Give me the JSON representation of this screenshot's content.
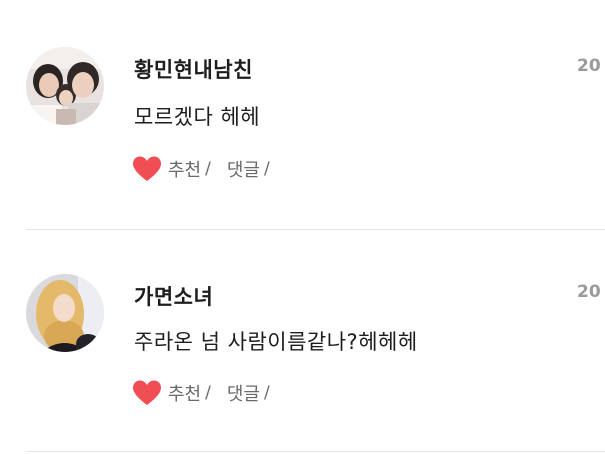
{
  "comments": [
    {
      "username": "황민현내남친",
      "date": "20",
      "body": "모르겠다 헤헤",
      "recommend_label": "추천",
      "reply_label": "댓글",
      "separator": "/"
    },
    {
      "username": "가면소녀",
      "date": "20",
      "body": "주라온 넘 사람이름같나?헤헤헤",
      "recommend_label": "추천",
      "reply_label": "댓글",
      "separator": "/"
    }
  ],
  "colors": {
    "heart": "#f04d55",
    "divider": "#e6e6e6",
    "meta_text": "#6a6a6a",
    "date_text": "#9a9a9a"
  },
  "icons": {
    "like": "heart-icon"
  }
}
